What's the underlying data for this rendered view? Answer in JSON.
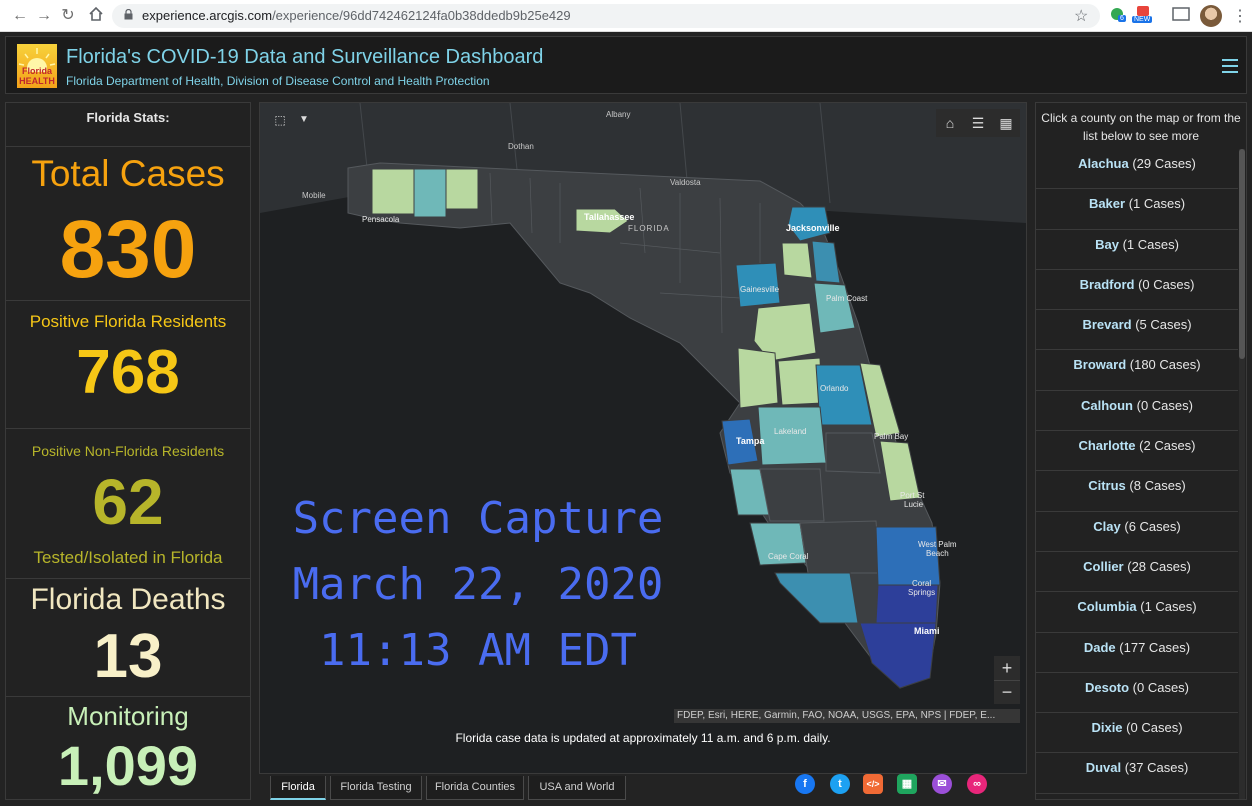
{
  "browser": {
    "url_host": "experience.arcgis.com",
    "url_path": "/experience/96dd742462124fa0b38ddedb9b25e429",
    "ext_badge_count": "6",
    "ext_badge_new": "NEW"
  },
  "header": {
    "logo_text": "Florida HEALTH",
    "title": "Florida's COVID-19 Data and Surveillance Dashboard",
    "subtitle": "Florida Department of Health, Division of Disease Control and Health Protection"
  },
  "stats": {
    "heading": "Florida Stats:",
    "total_cases_label": "Total Cases",
    "total_cases_value": "830",
    "residents_label": "Positive Florida Residents",
    "residents_value": "768",
    "nonresidents_label": "Positive Non-Florida Residents",
    "nonresidents_value": "62",
    "nonresidents_sub": "Tested/Isolated in Florida",
    "deaths_label": "Florida Deaths",
    "deaths_value": "13",
    "monitoring_label": "Monitoring",
    "monitoring_value": "1,099"
  },
  "map": {
    "labels": {
      "albany": "Albany",
      "dothan": "Dothan",
      "valdosta": "Valdosta",
      "mobile": "Mobile",
      "pensacola": "Pensacola",
      "tallahassee": "Tallahassee",
      "florida": "FLORIDA",
      "jacksonville": "Jacksonville",
      "gainesville": "Gainesville",
      "palm_coast": "Palm Coast",
      "orlando": "Orlando",
      "tampa": "Tampa",
      "lakeland": "Lakeland",
      "palm_bay": "Palm Bay",
      "port_st": "Port St",
      "lucie": "Lucie",
      "west_palm": "West Palm",
      "beach": "Beach",
      "cape_coral": "Cape Coral",
      "coral": "Coral",
      "springs": "Springs",
      "miami": "Miami"
    },
    "attribution": "FDEP, Esri, HERE, Garmin, FAO, NOAA, USGS, EPA, NPS | FDEP, E...",
    "zoom_in": "+",
    "zoom_out": "−",
    "update_note": "Florida case data is updated at approximately 11 a.m. and 6 p.m. daily.",
    "colors": {
      "low": "#b8d8a0",
      "mid": "#6fb8b8",
      "high": "#2f8fb8",
      "higher": "#2d6fb8",
      "highest": "#2d3f9a",
      "none": "#3c3f42"
    }
  },
  "overlay": {
    "line1": "Screen Capture",
    "line2": "March 22, 2020",
    "line3": "11:13 AM EDT"
  },
  "tabs": [
    {
      "label": "Florida"
    },
    {
      "label": "Florida Testing"
    },
    {
      "label": "Florida Counties"
    },
    {
      "label": "USA and World"
    }
  ],
  "counties": {
    "instructions": "Click a county on the map or from the list below to see more",
    "items": [
      {
        "name": "Alachua",
        "cases": "(29 Cases)"
      },
      {
        "name": "Baker",
        "cases": "(1 Cases)"
      },
      {
        "name": "Bay",
        "cases": "(1 Cases)"
      },
      {
        "name": "Bradford",
        "cases": "(0 Cases)"
      },
      {
        "name": "Brevard",
        "cases": "(5 Cases)"
      },
      {
        "name": "Broward",
        "cases": "(180 Cases)"
      },
      {
        "name": "Calhoun",
        "cases": "(0 Cases)"
      },
      {
        "name": "Charlotte",
        "cases": "(2 Cases)"
      },
      {
        "name": "Citrus",
        "cases": "(8 Cases)"
      },
      {
        "name": "Clay",
        "cases": "(6 Cases)"
      },
      {
        "name": "Collier",
        "cases": "(28 Cases)"
      },
      {
        "name": "Columbia",
        "cases": "(1 Cases)"
      },
      {
        "name": "Dade",
        "cases": "(177 Cases)"
      },
      {
        "name": "Desoto",
        "cases": "(0 Cases)"
      },
      {
        "name": "Dixie",
        "cases": "(0 Cases)"
      },
      {
        "name": "Duval",
        "cases": "(37 Cases)"
      }
    ]
  }
}
